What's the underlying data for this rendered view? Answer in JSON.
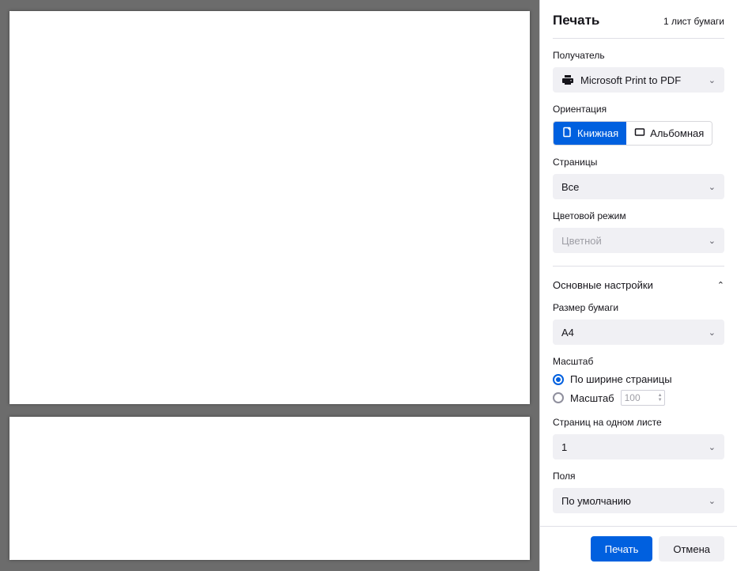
{
  "header": {
    "title": "Печать",
    "sheet_count": "1 лист бумаги"
  },
  "destination": {
    "label": "Получатель",
    "selected": "Microsoft Print to PDF"
  },
  "orientation": {
    "label": "Ориентация",
    "portrait": "Книжная",
    "landscape": "Альбомная"
  },
  "pages": {
    "label": "Страницы",
    "selected": "Все"
  },
  "color_mode": {
    "label": "Цветовой режим",
    "selected": "Цветной"
  },
  "more_settings": {
    "label": "Основные настройки"
  },
  "paper_size": {
    "label": "Размер бумаги",
    "selected": "A4"
  },
  "scale": {
    "label": "Масштаб",
    "fit_width": "По ширине страницы",
    "custom": "Масштаб",
    "value": "100"
  },
  "pages_per_sheet": {
    "label": "Страниц на одном листе",
    "selected": "1"
  },
  "margins": {
    "label": "Поля",
    "selected": "По умолчанию"
  },
  "footer": {
    "print": "Печать",
    "cancel": "Отмена"
  }
}
